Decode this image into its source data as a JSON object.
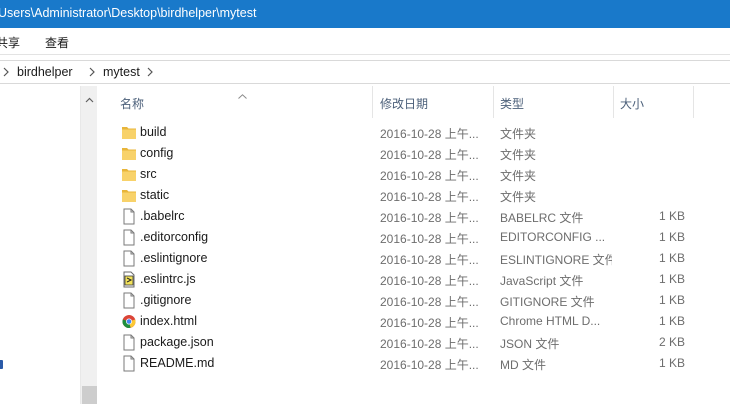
{
  "window": {
    "title": "Users\\Administrator\\Desktop\\birdhelper\\mytest"
  },
  "ribbon": {
    "tabs": [
      "共享",
      "查看"
    ]
  },
  "address": {
    "segments": [
      "birdhelper",
      "mytest"
    ]
  },
  "columns": {
    "name": "名称",
    "date": "修改日期",
    "type": "类型",
    "size": "大小"
  },
  "files": [
    {
      "name": "build",
      "date": "2016-10-28 上午...",
      "type": "文件夹",
      "size": "",
      "icon": "folder-icon"
    },
    {
      "name": "config",
      "date": "2016-10-28 上午...",
      "type": "文件夹",
      "size": "",
      "icon": "folder-icon"
    },
    {
      "name": "src",
      "date": "2016-10-28 上午...",
      "type": "文件夹",
      "size": "",
      "icon": "folder-icon"
    },
    {
      "name": "static",
      "date": "2016-10-28 上午...",
      "type": "文件夹",
      "size": "",
      "icon": "folder-icon"
    },
    {
      "name": ".babelrc",
      "date": "2016-10-28 上午...",
      "type": "BABELRC 文件",
      "size": "1 KB",
      "icon": "document-icon"
    },
    {
      "name": ".editorconfig",
      "date": "2016-10-28 上午...",
      "type": "EDITORCONFIG ...",
      "size": "1 KB",
      "icon": "document-icon"
    },
    {
      "name": ".eslintignore",
      "date": "2016-10-28 上午...",
      "type": "ESLINTIGNORE 文件",
      "size": "1 KB",
      "icon": "document-icon"
    },
    {
      "name": ".eslintrc.js",
      "date": "2016-10-28 上午...",
      "type": "JavaScript 文件",
      "size": "1 KB",
      "icon": "javascript-file-icon"
    },
    {
      "name": ".gitignore",
      "date": "2016-10-28 上午...",
      "type": "GITIGNORE 文件",
      "size": "1 KB",
      "icon": "document-icon"
    },
    {
      "name": "index.html",
      "date": "2016-10-28 上午...",
      "type": "Chrome HTML D...",
      "size": "1 KB",
      "icon": "chrome-icon"
    },
    {
      "name": "package.json",
      "date": "2016-10-28 上午...",
      "type": "JSON 文件",
      "size": "2 KB",
      "icon": "document-icon"
    },
    {
      "name": "README.md",
      "date": "2016-10-28 上午...",
      "type": "MD 文件",
      "size": "1 KB",
      "icon": "document-icon"
    }
  ],
  "colors": {
    "titlebar": "#1979ca",
    "header_text": "#4c607a",
    "folder": "#f5c84c",
    "meta_text": "#6d6d6d"
  }
}
